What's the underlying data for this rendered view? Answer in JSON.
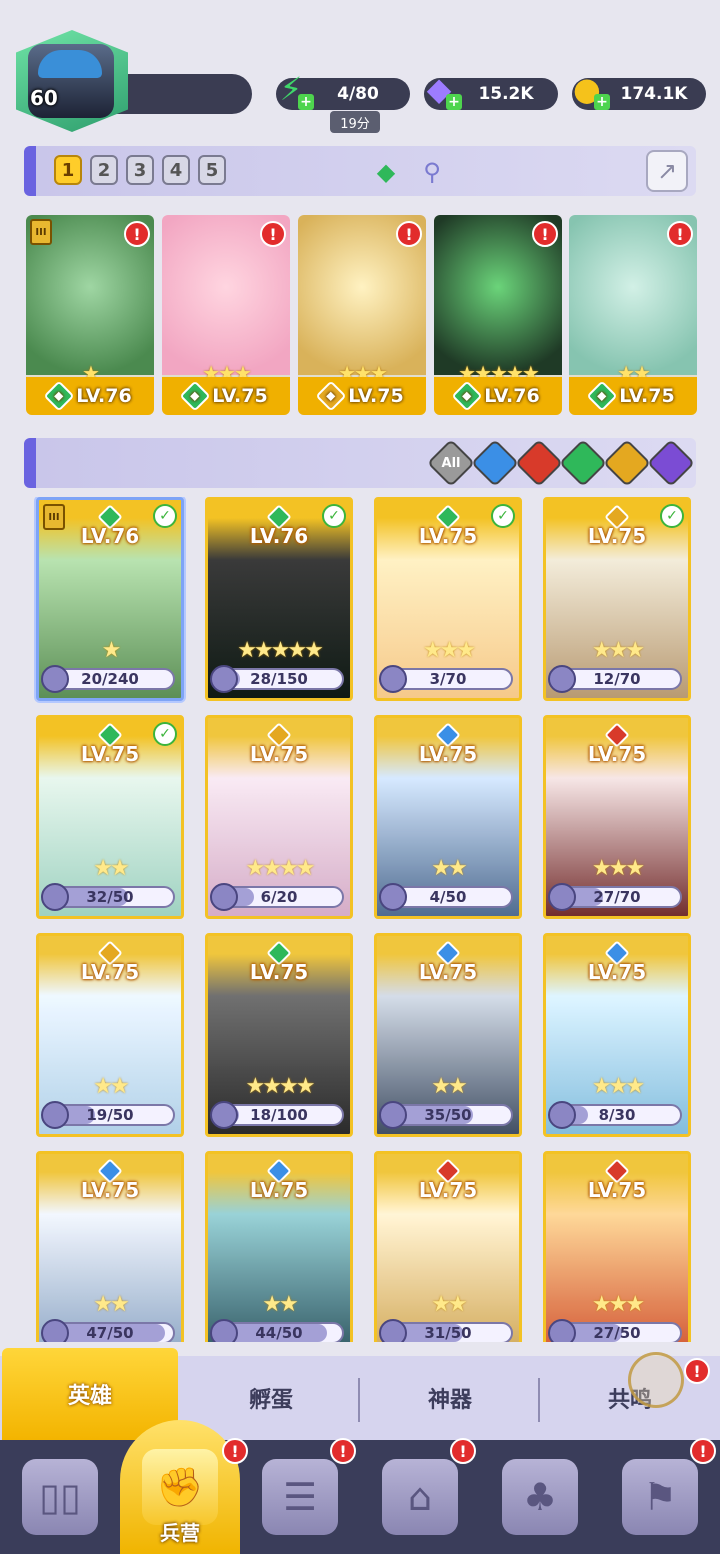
{
  "player": {
    "level": "60"
  },
  "resources": {
    "energy": {
      "value": "4/80",
      "timer": "19分",
      "icon": "lightning-icon"
    },
    "gems": {
      "value": "15.2K",
      "icon": "diamond-icon"
    },
    "gold": {
      "value": "174.1K",
      "icon": "coin-icon"
    }
  },
  "team_tabs": [
    "1",
    "2",
    "3",
    "4",
    "5"
  ],
  "team": [
    {
      "level": "LV.76",
      "element": "nature",
      "stars": "★",
      "tier": "III",
      "alert": "!"
    },
    {
      "level": "LV.75",
      "element": "nature",
      "stars": "★★★",
      "alert": "!"
    },
    {
      "level": "LV.75",
      "element": "light",
      "stars": "★★★",
      "alert": "!"
    },
    {
      "level": "LV.76",
      "element": "nature",
      "stars": "★★★★★",
      "alert": "!"
    },
    {
      "level": "LV.75",
      "element": "nature",
      "stars": "★★",
      "alert": "!"
    }
  ],
  "filters": [
    {
      "label": "All",
      "color": "#9a9a9a"
    },
    {
      "label": "",
      "color": "#3b8fe6",
      "name": "water"
    },
    {
      "label": "",
      "color": "#d83a2a",
      "name": "fire"
    },
    {
      "label": "",
      "color": "#2fb85a",
      "name": "nature"
    },
    {
      "label": "",
      "color": "#e4a820",
      "name": "light"
    },
    {
      "label": "",
      "color": "#7b4cd4",
      "name": "dark"
    }
  ],
  "heroes": [
    {
      "level": "LV.76",
      "element": "nature",
      "fragments": "20/240",
      "progress": 0.083,
      "stars": "★",
      "owned": true,
      "selected": true,
      "tier": "III"
    },
    {
      "level": "LV.76",
      "element": "nature",
      "fragments": "28/150",
      "progress": 0.187,
      "stars": "★★★★★",
      "owned": true
    },
    {
      "level": "LV.75",
      "element": "nature",
      "fragments": "3/70",
      "progress": 0.043,
      "stars": "★★★",
      "owned": true
    },
    {
      "level": "LV.75",
      "element": "light",
      "fragments": "12/70",
      "progress": 0.171,
      "stars": "★★★",
      "owned": true
    },
    {
      "level": "LV.75",
      "element": "nature",
      "fragments": "32/50",
      "progress": 0.64,
      "stars": "★★",
      "owned": true
    },
    {
      "level": "LV.75",
      "element": "light",
      "fragments": "6/20",
      "progress": 0.3,
      "stars": "★★★★",
      "owned": false
    },
    {
      "level": "LV.75",
      "element": "water",
      "fragments": "4/50",
      "progress": 0.08,
      "stars": "★★",
      "owned": false
    },
    {
      "level": "LV.75",
      "element": "fire",
      "fragments": "27/70",
      "progress": 0.386,
      "stars": "★★★",
      "owned": false
    },
    {
      "level": "LV.75",
      "element": "light",
      "fragments": "19/50",
      "progress": 0.38,
      "stars": "★★",
      "owned": false
    },
    {
      "level": "LV.75",
      "element": "nature",
      "fragments": "18/100",
      "progress": 0.18,
      "stars": "★★★★",
      "owned": false
    },
    {
      "level": "LV.75",
      "element": "water",
      "fragments": "35/50",
      "progress": 0.7,
      "stars": "★★",
      "owned": false
    },
    {
      "level": "LV.75",
      "element": "water",
      "fragments": "8/30",
      "progress": 0.267,
      "stars": "★★★",
      "owned": false
    },
    {
      "level": "LV.75",
      "element": "water",
      "fragments": "47/50",
      "progress": 0.94,
      "stars": "★★",
      "owned": false
    },
    {
      "level": "LV.75",
      "element": "water",
      "fragments": "44/50",
      "progress": 0.88,
      "stars": "★★",
      "owned": false
    },
    {
      "level": "LV.75",
      "element": "fire",
      "fragments": "31/50",
      "progress": 0.62,
      "stars": "★★",
      "owned": false
    },
    {
      "level": "LV.75",
      "element": "fire",
      "fragments": "27/50",
      "progress": 0.54,
      "stars": "★★★",
      "owned": false
    }
  ],
  "subtabs": [
    "英雄",
    "孵蛋",
    "神器",
    "共鸣"
  ],
  "nav": [
    {
      "name": "cards",
      "label": "",
      "alert": ""
    },
    {
      "name": "barracks",
      "label": "兵营",
      "alert": "!"
    },
    {
      "name": "quests",
      "label": "",
      "alert": "!"
    },
    {
      "name": "shop",
      "label": "",
      "alert": "!"
    },
    {
      "name": "guild",
      "label": "",
      "alert": ""
    },
    {
      "name": "arena",
      "label": "",
      "alert": "!"
    }
  ],
  "element_colors": {
    "nature": "#2fb85a",
    "light": "#e4a820",
    "water": "#3b8fe6",
    "fire": "#d83a2a",
    "dark": "#7b4cd4"
  }
}
